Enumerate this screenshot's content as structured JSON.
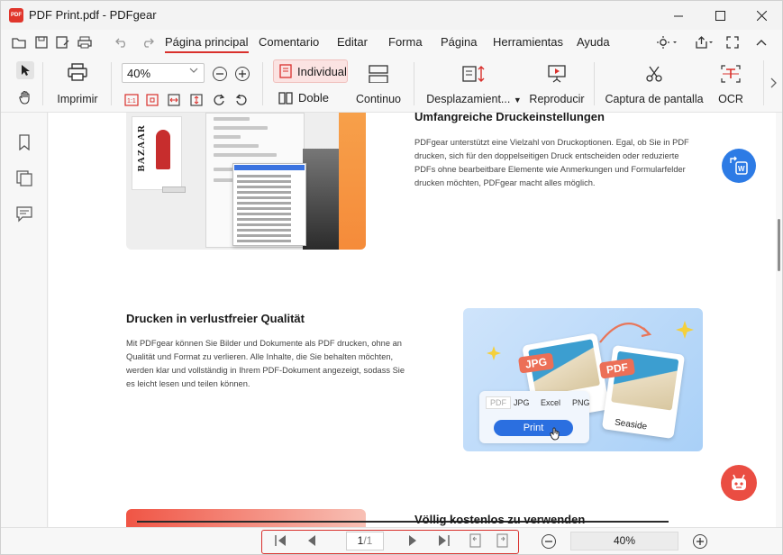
{
  "window": {
    "title": "PDF Print.pdf - PDFgear",
    "logo_text": "PDF"
  },
  "menu": {
    "items": [
      "Página principal",
      "Comentario",
      "Editar",
      "Forma",
      "Página",
      "Herramientas",
      "Ayuda"
    ],
    "active": "Página principal"
  },
  "ribbon": {
    "print_label": "Imprimir",
    "zoom_value": "40%",
    "individual_label": "Individual",
    "double_label": "Doble",
    "continuous_label": "Continuo",
    "scroll_label": "Desplazamient...",
    "play_label": "Reproducir",
    "capture_label": "Captura de pantalla",
    "ocr_label": "OCR"
  },
  "document": {
    "section1": {
      "heading": "Umfangreiche Druckeinstellungen",
      "lines": [
        "PDFgear unterstützt eine Vielzahl von Druckoptionen. Egal, ob Sie in PDF",
        "drucken, sich für den doppelseitigen Druck entscheiden oder reduzierte",
        "PDFs ohne bearbeitbare Elemente wie Anmerkungen und Formularfelder",
        "drucken möchten, PDFgear macht alles möglich."
      ]
    },
    "section2": {
      "heading": "Drucken in verlustfreier Qualität",
      "lines": [
        "Mit PDFgear können Sie Bilder und Dokumente als PDF drucken, ohne an",
        "Qualität und Format zu verlieren. Alle Inhalte, die Sie behalten möchten,",
        "werden klar und vollständig in Ihrem PDF-Dokument angezeigt, sodass Sie",
        "es leicht lesen und teilen können."
      ]
    },
    "section3": {
      "heading": "Völlig kostenlos zu verwenden"
    },
    "illustration1": {
      "magazine_title": "BAZAAR"
    },
    "illustration2": {
      "jpg_badge": "JPG",
      "pdf_badge": "PDF",
      "formats": [
        "PDF",
        "JPG",
        "Excel",
        "PNG"
      ],
      "print_button": "Print",
      "caption": "Seaside"
    }
  },
  "status": {
    "current_page": "1",
    "total_pages": "/1",
    "zoom": "40%"
  },
  "colors": {
    "accent": "#d9302c",
    "print_blue": "#2b6fe0"
  }
}
